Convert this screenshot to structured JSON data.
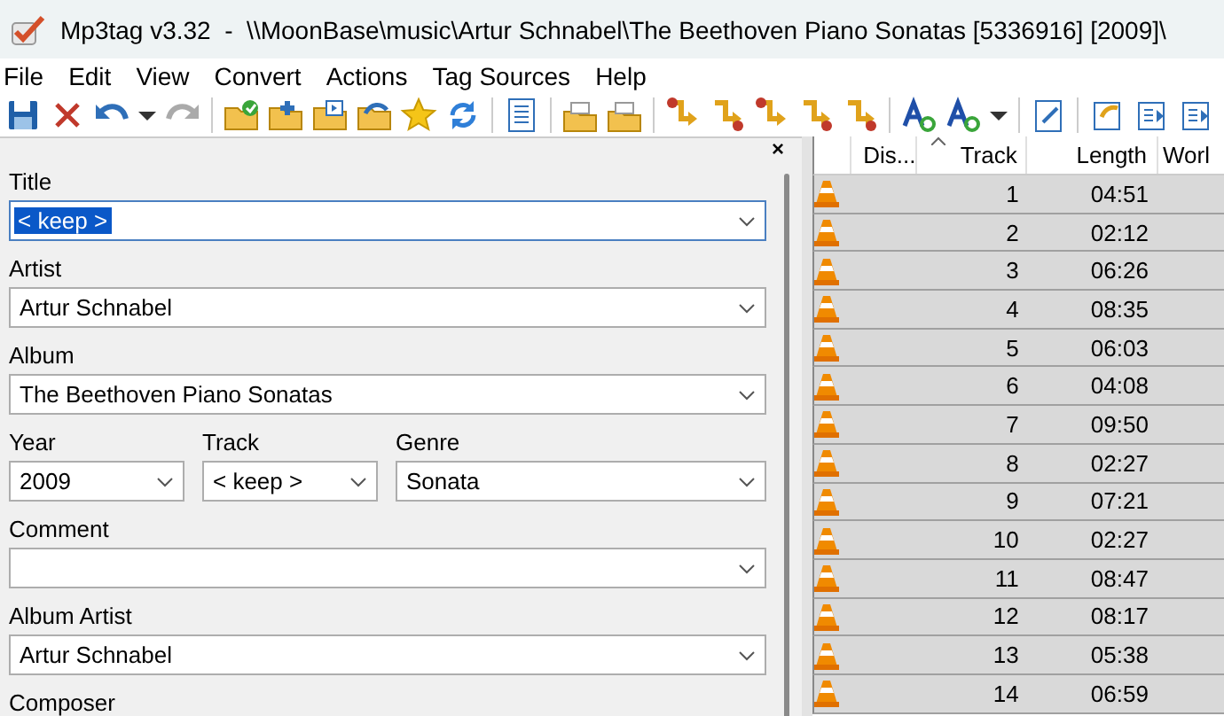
{
  "window": {
    "title": "Mp3tag v3.32  -  \\\\MoonBase\\music\\Artur Schnabel\\The Beethoven Piano Sonatas [5336916] [2009]\\"
  },
  "menu": [
    "File",
    "Edit",
    "View",
    "Convert",
    "Actions",
    "Tag Sources",
    "Help"
  ],
  "tag_panel": {
    "close": "×",
    "rows": [
      [
        {
          "label": "Title",
          "value": "< keep >",
          "kind": "combo",
          "focused": true,
          "text_selected": true
        }
      ],
      [
        {
          "label": "Artist",
          "value": "Artur Schnabel",
          "kind": "combo",
          "focused": false,
          "text_selected": false
        }
      ],
      [
        {
          "label": "Album",
          "value": "The Beethoven Piano Sonatas",
          "kind": "combo",
          "focused": false,
          "text_selected": false
        }
      ],
      [
        {
          "label": "Year",
          "value": "2009",
          "kind": "combo",
          "focused": false,
          "text_selected": false
        },
        {
          "label": "Track",
          "value": "< keep >",
          "kind": "combo",
          "focused": false,
          "text_selected": false
        },
        {
          "label": "Genre",
          "value": "Sonata",
          "kind": "combo",
          "focused": false,
          "text_selected": false
        }
      ],
      [
        {
          "label": "Comment",
          "kind": "combo",
          "focused": false
        }
      ],
      [
        {
          "label": "Album Artist",
          "value": "Artur Schnabel",
          "kind": "combo",
          "focused": false,
          "text_selected": false
        }
      ],
      [
        {
          "label": "Composer",
          "kind": "label"
        }
      ]
    ]
  },
  "file_list": {
    "columns": [
      {
        "label": "Dis...",
        "sorted": false
      },
      {
        "label": "Track",
        "sorted": true
      },
      {
        "label": "Length",
        "sorted": false
      },
      {
        "label": "Worl",
        "sorted": false
      }
    ],
    "rows": [
      {
        "track": "1",
        "length": "04:51",
        "selected": true
      },
      {
        "track": "2",
        "length": "02:12",
        "selected": true
      },
      {
        "track": "3",
        "length": "06:26",
        "selected": true
      },
      {
        "track": "4",
        "length": "08:35",
        "selected": true
      },
      {
        "track": "5",
        "length": "06:03",
        "selected": true
      },
      {
        "track": "6",
        "length": "04:08",
        "selected": true
      },
      {
        "track": "7",
        "length": "09:50",
        "selected": true
      },
      {
        "track": "8",
        "length": "02:27",
        "selected": true
      },
      {
        "track": "9",
        "length": "07:21",
        "selected": true
      },
      {
        "track": "10",
        "length": "02:27",
        "selected": true
      },
      {
        "track": "11",
        "length": "08:47",
        "selected": true
      },
      {
        "track": "12",
        "length": "08:17",
        "selected": true
      },
      {
        "track": "13",
        "length": "05:38",
        "selected": true
      },
      {
        "track": "14",
        "length": "06:59",
        "selected": true
      }
    ]
  }
}
